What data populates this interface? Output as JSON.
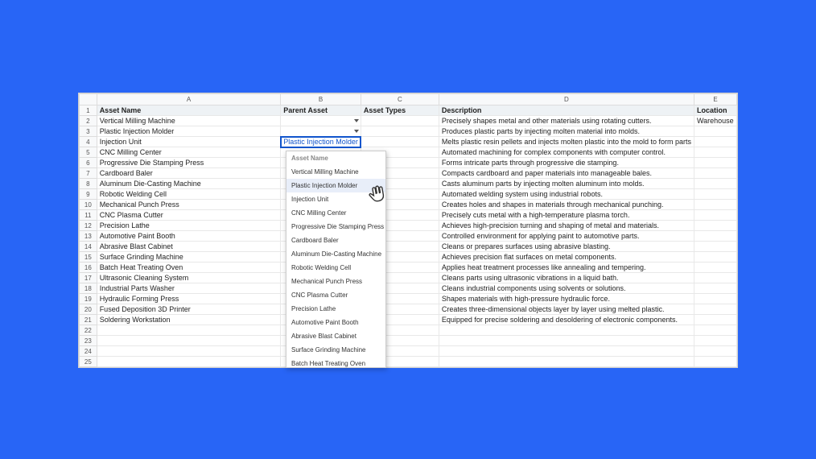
{
  "columns": {
    "A": "A",
    "B": "B",
    "C": "C",
    "D": "D",
    "E": "E"
  },
  "headers": {
    "asset_name": "Asset Name",
    "parent_asset": "Parent Asset",
    "asset_types": "Asset Types",
    "description": "Description",
    "location": "Location"
  },
  "active_cell_value": "Plastic Injection Molder",
  "rows": [
    {
      "n": "2",
      "name": "Vertical Milling Machine",
      "parent": "",
      "hasDropdown": true,
      "types": "",
      "desc": "Precisely shapes metal and other materials using rotating cutters.",
      "loc": "Warehouse"
    },
    {
      "n": "3",
      "name": "Plastic Injection Molder",
      "parent": "",
      "hasDropdown": true,
      "types": "",
      "desc": "Produces plastic parts by injecting molten material into molds.",
      "loc": ""
    },
    {
      "n": "4",
      "name": "Injection Unit",
      "parent": "Plastic Injection Molder",
      "active": true,
      "types": "",
      "desc": "Melts plastic resin pellets and injects molten plastic into the mold to form parts",
      "loc": ""
    },
    {
      "n": "5",
      "name": "CNC Milling Center",
      "parent": "",
      "types": "",
      "desc": "Automated machining for complex components with computer control.",
      "loc": ""
    },
    {
      "n": "6",
      "name": "Progressive Die Stamping Press",
      "parent": "",
      "types": "",
      "desc": "Forms intricate parts through progressive die stamping.",
      "loc": ""
    },
    {
      "n": "7",
      "name": "Cardboard Baler",
      "parent": "",
      "types": "",
      "desc": "Compacts cardboard and paper materials into manageable bales.",
      "loc": ""
    },
    {
      "n": "8",
      "name": "Aluminum Die-Casting Machine",
      "parent": "",
      "types": "",
      "desc": "Casts aluminum parts by injecting molten aluminum into molds.",
      "loc": ""
    },
    {
      "n": "9",
      "name": "Robotic Welding Cell",
      "parent": "",
      "types": "",
      "desc": "Automated welding system using industrial robots.",
      "loc": ""
    },
    {
      "n": "10",
      "name": "Mechanical Punch Press",
      "parent": "",
      "types": "",
      "desc": "Creates holes and shapes in materials through mechanical punching.",
      "loc": ""
    },
    {
      "n": "11",
      "name": "CNC Plasma Cutter",
      "parent": "",
      "types": "",
      "desc": "Precisely cuts metal with a high-temperature plasma torch.",
      "loc": ""
    },
    {
      "n": "12",
      "name": "Precision Lathe",
      "parent": "",
      "types": "",
      "desc": "Achieves high-precision turning and shaping of metal and materials.",
      "loc": ""
    },
    {
      "n": "13",
      "name": "Automotive Paint Booth",
      "parent": "",
      "types": "",
      "desc": "Controlled environment for applying paint to automotive parts.",
      "loc": ""
    },
    {
      "n": "14",
      "name": "Abrasive Blast Cabinet",
      "parent": "",
      "types": "",
      "desc": "Cleans or prepares surfaces using abrasive blasting.",
      "loc": ""
    },
    {
      "n": "15",
      "name": "Surface Grinding Machine",
      "parent": "",
      "types": "",
      "desc": "Achieves precision flat surfaces on metal components.",
      "loc": ""
    },
    {
      "n": "16",
      "name": "Batch Heat Treating Oven",
      "parent": "",
      "types": "",
      "desc": "Applies heat treatment processes like annealing and tempering.",
      "loc": ""
    },
    {
      "n": "17",
      "name": "Ultrasonic Cleaning System",
      "parent": "",
      "types": "",
      "desc": "Cleans parts using ultrasonic vibrations in a liquid bath.",
      "loc": ""
    },
    {
      "n": "18",
      "name": "Industrial Parts Washer",
      "parent": "",
      "types": "",
      "desc": "Cleans industrial components using solvents or solutions.",
      "loc": ""
    },
    {
      "n": "19",
      "name": "Hydraulic Forming Press",
      "parent": "",
      "types": "",
      "desc": "Shapes materials with high-pressure hydraulic force.",
      "loc": ""
    },
    {
      "n": "20",
      "name": "Fused Deposition 3D Printer",
      "parent": "",
      "types": "",
      "desc": "Creates three-dimensional objects layer by layer using melted plastic.",
      "loc": ""
    },
    {
      "n": "21",
      "name": "Soldering Workstation",
      "parent": "",
      "types": "",
      "desc": "Equipped for precise soldering and desoldering of electronic components.",
      "loc": ""
    },
    {
      "n": "22",
      "name": "",
      "parent": "",
      "types": "",
      "desc": "",
      "loc": ""
    },
    {
      "n": "23",
      "name": "",
      "parent": "",
      "types": "",
      "desc": "",
      "loc": ""
    },
    {
      "n": "24",
      "name": "",
      "parent": "",
      "types": "",
      "desc": "",
      "loc": ""
    },
    {
      "n": "25",
      "name": "",
      "parent": "",
      "types": "",
      "desc": "",
      "loc": ""
    }
  ],
  "dropdown": {
    "header": "Asset Name",
    "highlighted_index": 1,
    "items": [
      "Vertical Milling Machine",
      "Plastic Injection Molder",
      "Injection Unit",
      "CNC Milling Center",
      "Progressive Die Stamping Press",
      "Cardboard Baler",
      "Aluminum Die-Casting Machine",
      "Robotic Welding Cell",
      "Mechanical Punch Press",
      "CNC Plasma Cutter",
      "Precision Lathe",
      "Automotive Paint Booth",
      "Abrasive Blast Cabinet",
      "Surface Grinding Machine",
      "Batch Heat Treating Oven"
    ]
  },
  "hand_cursor": "☜"
}
